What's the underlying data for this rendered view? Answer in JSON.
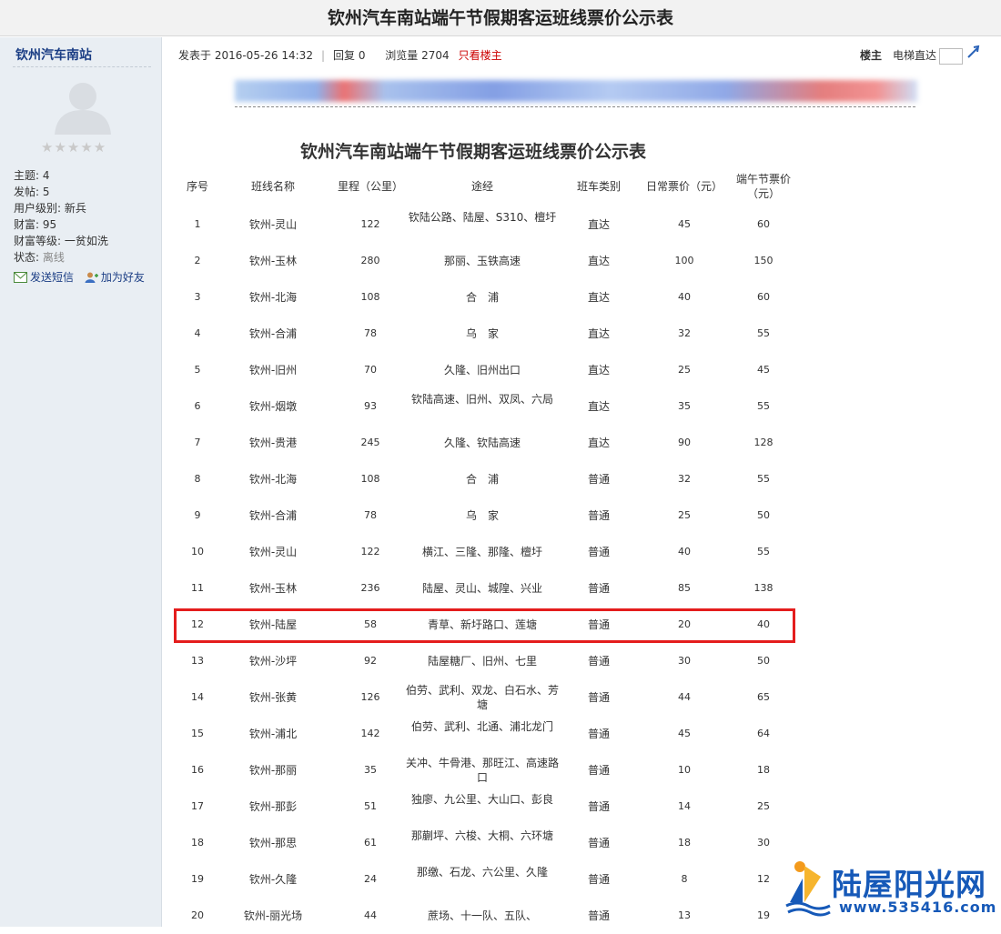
{
  "page_title": "钦州汽车南站端午节假期客运班线票价公示表",
  "sidebar": {
    "author": "钦州汽车南站",
    "stars": "★★★★★",
    "info": [
      {
        "label": "主题: ",
        "value": "4"
      },
      {
        "label": "发帖: ",
        "value": "5"
      },
      {
        "label": "用户级别: ",
        "value": "新兵"
      },
      {
        "label": "财富: ",
        "value": "95"
      },
      {
        "label": "财富等级: ",
        "value": "一贫如洗"
      },
      {
        "label": "状态: ",
        "value": "离线"
      }
    ],
    "send_message": "发送短信",
    "add_friend": "加为好友"
  },
  "post_meta": {
    "posted": "发表于 2016-05-26 14:32",
    "replies": "回复 0",
    "views": "浏览量 2704",
    "only_author": "只看楼主",
    "floor": "楼主",
    "jump": "电梯直达"
  },
  "doc_title": "钦州汽车南站端午节假期客运班线票价公示表",
  "table": {
    "headers": [
      "序号",
      "班线名称",
      "里程（公里）",
      "途经",
      "班车类别",
      "日常票价（元）",
      "端午节票价（元）"
    ],
    "rows": [
      [
        "1",
        "钦州-灵山",
        "122",
        "钦陆公路、陆屋、S310、檀圩",
        "直达",
        "45",
        "60"
      ],
      [
        "2",
        "钦州-玉林",
        "280",
        "那丽、玉铁高速",
        "直达",
        "100",
        "150"
      ],
      [
        "3",
        "钦州-北海",
        "108",
        "合　浦",
        "直达",
        "40",
        "60"
      ],
      [
        "4",
        "钦州-合浦",
        "78",
        "乌　家",
        "直达",
        "32",
        "55"
      ],
      [
        "5",
        "钦州-旧州",
        "70",
        "久隆、旧州出口",
        "直达",
        "25",
        "45"
      ],
      [
        "6",
        "钦州-烟墩",
        "93",
        "钦陆高速、旧州、双凤、六局",
        "直达",
        "35",
        "55"
      ],
      [
        "7",
        "钦州-贵港",
        "245",
        "久隆、钦陆高速",
        "直达",
        "90",
        "128"
      ],
      [
        "8",
        "钦州-北海",
        "108",
        "合　浦",
        "普通",
        "32",
        "55"
      ],
      [
        "9",
        "钦州-合浦",
        "78",
        "乌　家",
        "普通",
        "25",
        "50"
      ],
      [
        "10",
        "钦州-灵山",
        "122",
        "横江、三隆、那隆、檀圩",
        "普通",
        "40",
        "55"
      ],
      [
        "11",
        "钦州-玉林",
        "236",
        "陆屋、灵山、城隍、兴业",
        "普通",
        "85",
        "138"
      ],
      [
        "12",
        "钦州-陆屋",
        "58",
        "青草、新圩路口、莲塘",
        "普通",
        "20",
        "40"
      ],
      [
        "13",
        "钦州-沙坪",
        "92",
        "陆屋糖厂、旧州、七里",
        "普通",
        "30",
        "50"
      ],
      [
        "14",
        "钦州-张黄",
        "126",
        "伯劳、武利、双龙、白石水、芳塘",
        "普通",
        "44",
        "65"
      ],
      [
        "15",
        "钦州-浦北",
        "142",
        "伯劳、武利、北通、浦北龙门",
        "普通",
        "45",
        "64"
      ],
      [
        "16",
        "钦州-那丽",
        "35",
        "关冲、牛骨港、那旺江、高速路口",
        "普通",
        "10",
        "18"
      ],
      [
        "17",
        "钦州-那彭",
        "51",
        "独廖、九公里、大山口、彭良",
        "普通",
        "14",
        "25"
      ],
      [
        "18",
        "钦州-那思",
        "61",
        "那蒯坪、六梭、大桐、六环塘",
        "普通",
        "18",
        "30"
      ],
      [
        "19",
        "钦州-久隆",
        "24",
        "那缴、石龙、六公里、久隆",
        "普通",
        "8",
        "12"
      ],
      [
        "20",
        "钦州-丽光场",
        "44",
        "蔗场、十一队、五队、",
        "普通",
        "13",
        "19"
      ]
    ]
  },
  "watermark": {
    "text": "陆屋阳光网",
    "url": "www.535416.com"
  },
  "colors": {
    "accent_blue": "#1a3d84",
    "highlight_red": "#e41d1d",
    "watermark_blue": "#1659b8"
  }
}
